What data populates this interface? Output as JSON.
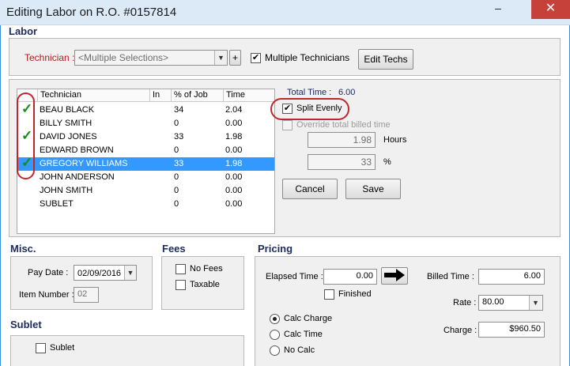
{
  "window": {
    "title": "Editing Labor on R.O. #0157814",
    "minimize": "–",
    "close": "✕"
  },
  "labor": {
    "section": "Labor",
    "technician_label": "Technician :",
    "technician_value": "<Multiple Selections>",
    "add_button": "+",
    "multiple_label": "Multiple Technicians",
    "multiple_checked": true,
    "edit_techs": "Edit Techs",
    "total_time_label": "Total Time :",
    "total_time_value": "6.00",
    "split_evenly": "Split Evenly",
    "split_checked": true,
    "override_label": "Override total billed time",
    "hours_value": "1.98",
    "hours_label": "Hours",
    "percent_value": "33",
    "percent_label": "%",
    "cancel": "Cancel",
    "save": "Save"
  },
  "grid": {
    "columns": [
      "Technician",
      "In",
      "% of Job",
      "Time"
    ],
    "rows": [
      {
        "name": "BEAU BLACK",
        "in": "",
        "pct": "34",
        "time": "2.04",
        "checked": true,
        "selected": false
      },
      {
        "name": "BILLY SMITH",
        "in": "",
        "pct": "0",
        "time": "0.00",
        "checked": false,
        "selected": false
      },
      {
        "name": "DAVID JONES",
        "in": "",
        "pct": "33",
        "time": "1.98",
        "checked": true,
        "selected": false
      },
      {
        "name": "EDWARD BROWN",
        "in": "",
        "pct": "0",
        "time": "0.00",
        "checked": false,
        "selected": false
      },
      {
        "name": "GREGORY WILLIAMS",
        "in": "",
        "pct": "33",
        "time": "1.98",
        "checked": true,
        "selected": true
      },
      {
        "name": "JOHN ANDERSON",
        "in": "",
        "pct": "0",
        "time": "0.00",
        "checked": false,
        "selected": false
      },
      {
        "name": "JOHN SMITH",
        "in": "",
        "pct": "0",
        "time": "0.00",
        "checked": false,
        "selected": false
      },
      {
        "name": "SUBLET",
        "in": "",
        "pct": "0",
        "time": "0.00",
        "checked": false,
        "selected": false
      }
    ]
  },
  "misc": {
    "section": "Misc.",
    "pay_date_label": "Pay Date :",
    "pay_date_value": "02/09/2016",
    "item_number_label": "Item Number :",
    "item_number_value": "02"
  },
  "fees": {
    "section": "Fees",
    "no_fees": "No Fees",
    "taxable": "Taxable"
  },
  "sublet": {
    "section": "Sublet",
    "sublet_label": "Sublet"
  },
  "pricing": {
    "section": "Pricing",
    "elapsed_label": "Elapsed Time :",
    "elapsed_value": "0.00",
    "finished_label": "Finished",
    "billed_label": "Billed Time :",
    "billed_value": "6.00",
    "rate_label": "Rate :",
    "rate_value": "80.00",
    "charge_label": "Charge :",
    "charge_value": "$960.50",
    "calc_charge": "Calc Charge",
    "calc_time": "Calc Time",
    "no_calc": "No Calc",
    "selected_mode": "calc_charge"
  },
  "icons": {
    "check": "check-icon",
    "arrow": "arrow-right-icon",
    "dropdown": "chevron-down-icon"
  },
  "colors": {
    "accent_red": "#c0272d",
    "selection": "#3399ff",
    "navy": "#1c2a5c",
    "tick_green": "#1a8a1a"
  }
}
